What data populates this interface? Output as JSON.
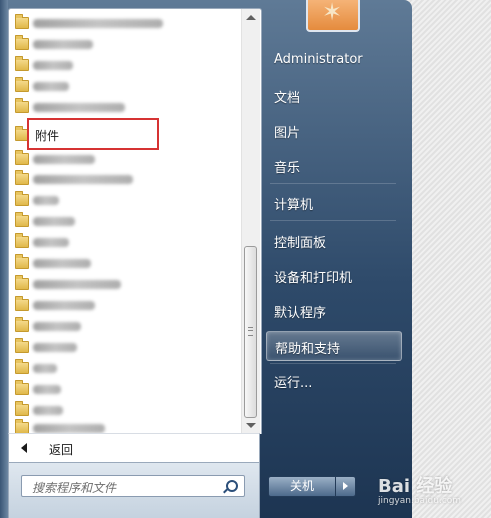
{
  "program_list": {
    "accessories_label": "附件"
  },
  "back_label": "返回",
  "search": {
    "placeholder": "搜索程序和文件"
  },
  "user": {
    "name": "Administrator"
  },
  "right_items": {
    "documents": "文档",
    "pictures": "图片",
    "music": "音乐",
    "computer": "计算机",
    "control_panel": "控制面板",
    "devices_printers": "设备和打印机",
    "default_programs": "默认程序",
    "help_support": "帮助和支持",
    "run": "运行..."
  },
  "shutdown": {
    "label": "关机"
  },
  "watermark": {
    "logo": "Bai 经验",
    "url": "jingyan.baidu.com"
  },
  "colors": {
    "highlight_border": "#d63333",
    "menu_glass_top": "#5f7a96",
    "menu_glass_bottom": "#1d3552"
  },
  "icons": {
    "folder": "folder-icon",
    "search": "search-icon",
    "back": "back-arrow-icon",
    "shutdown_options": "arrow-right-icon",
    "user": "starfish-icon"
  }
}
